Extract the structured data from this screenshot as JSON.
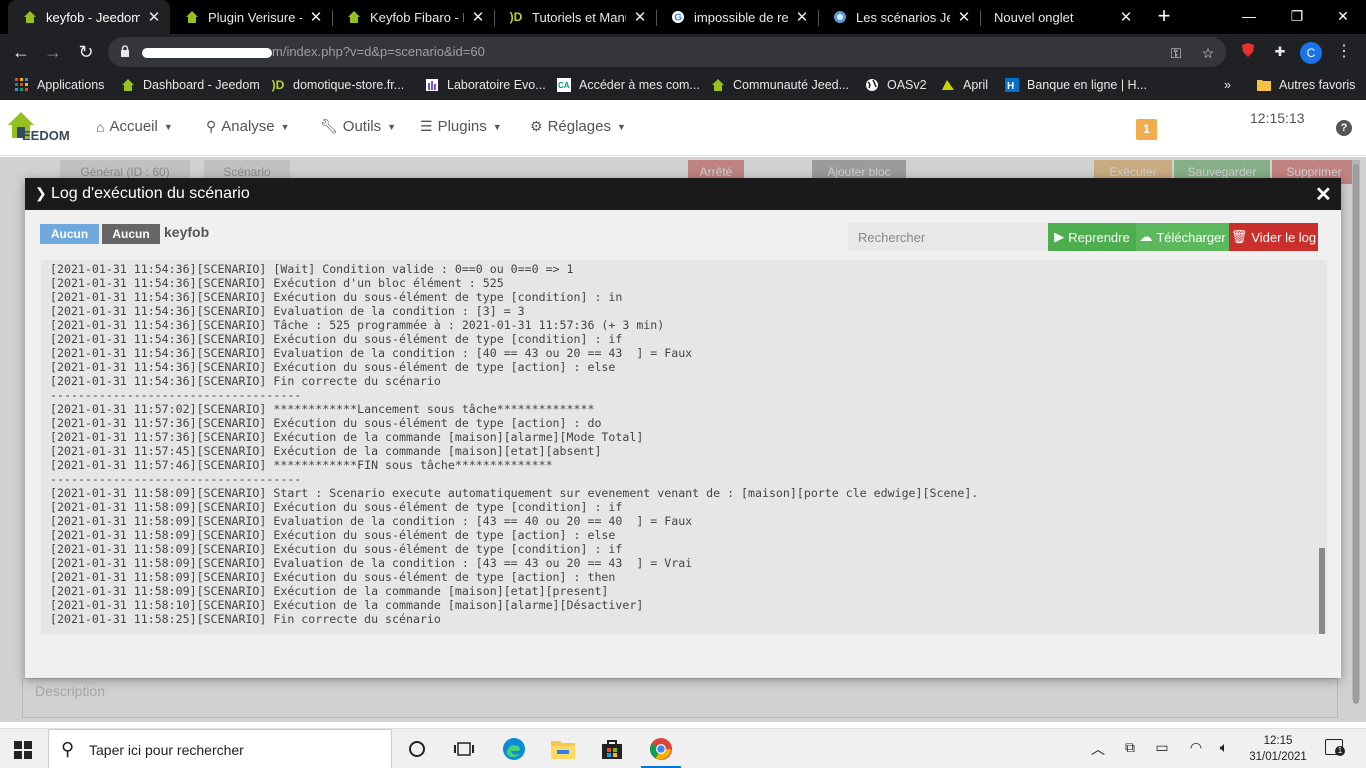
{
  "browser": {
    "tabs": [
      {
        "title": "keyfob - Jeedom",
        "active": true
      },
      {
        "title": "Plugin Verisure - P"
      },
      {
        "title": "Keyfob Fibaro - Pa"
      },
      {
        "title": "Tutoriels et Manue"
      },
      {
        "title": "impossible de reve"
      },
      {
        "title": "Les scénarios Jeed"
      },
      {
        "title": "Nouvel onglet"
      }
    ],
    "url_visible": "m/index.php?v=d&p=scenario&id=60",
    "profile_initial": "C",
    "bookmarks": [
      "Applications",
      "Dashboard - Jeedom",
      "domotique-store.fr...",
      "Laboratoire Evo...",
      "Accéder à mes com...",
      "Communauté Jeed...",
      "OASv2",
      "April",
      "Banque en ligne | H...",
      "Autres favoris"
    ]
  },
  "jeedom": {
    "logo_text": "EEDOM",
    "menu": [
      {
        "label": "Accueil",
        "icon": "home-icon"
      },
      {
        "label": "Analyse",
        "icon": "analyse-icon"
      },
      {
        "label": "Outils",
        "icon": "wrench-icon"
      },
      {
        "label": "Plugins",
        "icon": "list-icon"
      },
      {
        "label": "Réglages",
        "icon": "cog-icon"
      }
    ],
    "message_count": "1",
    "clock": "12:15:13"
  },
  "background_page": {
    "tab_general": "Général (ID : 60)",
    "tab_scenario": "Scénario",
    "status": "Arrêté",
    "add_block": "Ajouter bloc",
    "execute": "Exécuter",
    "save": "Sauvegarder",
    "delete": "Supprimer",
    "description_placeholder": "Description"
  },
  "modal": {
    "title": "Log d'exécution du scénario",
    "filter_btn_1": "Aucun",
    "filter_btn_2": "Aucun",
    "scenario_name": "keyfob",
    "search_placeholder": "Rechercher",
    "resume_label": "Reprendre",
    "download_label": "Télécharger",
    "clear_label": "Vider le log",
    "colors": {
      "resume": "#4cae4c",
      "download": "#5cb85c",
      "clear": "#c9302c",
      "filter1": "#6fa8dc",
      "filter2": "#666666"
    },
    "log_lines": [
      "[2021-01-31 11:54:36][SCENARIO] [Wait] Condition valide : 0==0 ou 0==0 => 1",
      "[2021-01-31 11:54:36][SCENARIO] Exécution d'un bloc élément : 525",
      "[2021-01-31 11:54:36][SCENARIO] Exécution du sous-élément de type [condition] : in",
      "[2021-01-31 11:54:36][SCENARIO] Evaluation de la condition : [3] = 3",
      "[2021-01-31 11:54:36][SCENARIO] Tâche : 525 programmée à : 2021-01-31 11:57:36 (+ 3 min)",
      "[2021-01-31 11:54:36][SCENARIO] Exécution du sous-élément de type [condition] : if",
      "[2021-01-31 11:54:36][SCENARIO] Evaluation de la condition : [40 == 43 ou 20 == 43  ] = Faux",
      "[2021-01-31 11:54:36][SCENARIO] Exécution du sous-élément de type [action] : else",
      "[2021-01-31 11:54:36][SCENARIO] Fin correcte du scénario",
      "------------------------------------",
      "[2021-01-31 11:57:02][SCENARIO] ************Lancement sous tâche**************",
      "[2021-01-31 11:57:36][SCENARIO] Exécution du sous-élément de type [action] : do",
      "[2021-01-31 11:57:36][SCENARIO] Exécution de la commande [maison][alarme][Mode Total]",
      "[2021-01-31 11:57:45][SCENARIO] Exécution de la commande [maison][etat][absent]",
      "[2021-01-31 11:57:46][SCENARIO] ************FIN sous tâche**************",
      "------------------------------------",
      "[2021-01-31 11:58:09][SCENARIO] Start : Scenario execute automatiquement sur evenement venant de : [maison][porte cle edwige][Scene].",
      "[2021-01-31 11:58:09][SCENARIO] Exécution du sous-élément de type [condition] : if",
      "[2021-01-31 11:58:09][SCENARIO] Evaluation de la condition : [43 == 40 ou 20 == 40  ] = Faux",
      "[2021-01-31 11:58:09][SCENARIO] Exécution du sous-élément de type [action] : else",
      "[2021-01-31 11:58:09][SCENARIO] Exécution du sous-élément de type [condition] : if",
      "[2021-01-31 11:58:09][SCENARIO] Evaluation de la condition : [43 == 43 ou 20 == 43  ] = Vrai",
      "[2021-01-31 11:58:09][SCENARIO] Exécution du sous-élément de type [action] : then",
      "[2021-01-31 11:58:09][SCENARIO] Exécution de la commande [maison][etat][present]",
      "[2021-01-31 11:58:10][SCENARIO] Exécution de la commande [maison][alarme][Désactiver]",
      "[2021-01-31 11:58:25][SCENARIO] Fin correcte du scénario"
    ]
  },
  "taskbar": {
    "search_placeholder": "Taper ici pour rechercher",
    "time": "12:15",
    "date": "31/01/2021"
  }
}
